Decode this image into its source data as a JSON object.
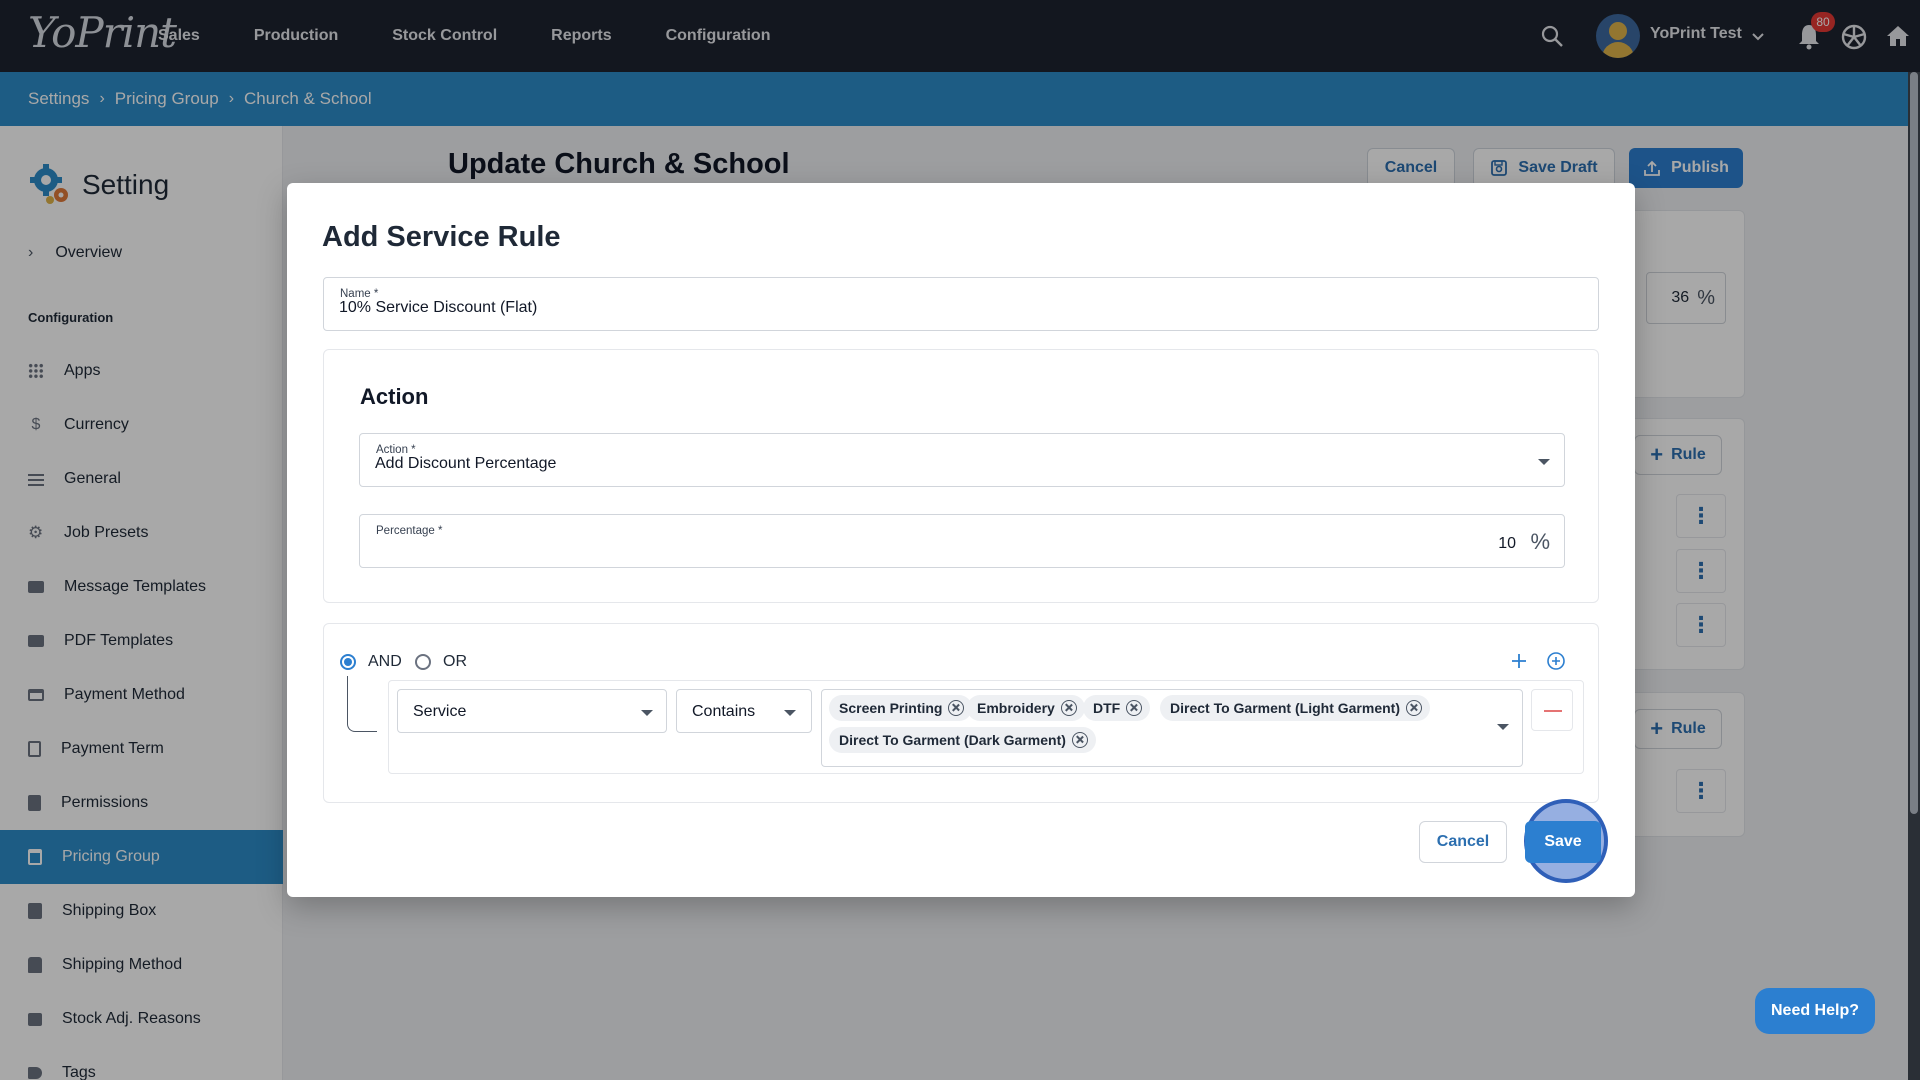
{
  "app": {
    "logo_text": "YoPrint"
  },
  "topnav": {
    "items": [
      "Sales",
      "Production",
      "Stock Control",
      "Reports",
      "Configuration"
    ],
    "user_name": "YoPrint Test",
    "notification_count": "80"
  },
  "breadcrumb": [
    "Settings",
    "Pricing Group",
    "Church & School"
  ],
  "sidebar": {
    "title": "Setting",
    "overview": "Overview",
    "section_label": "Configuration",
    "items": [
      {
        "label": "Apps",
        "icon": "apps-grid-icon"
      },
      {
        "label": "Currency",
        "icon": "dollar-icon"
      },
      {
        "label": "General",
        "icon": "sliders-icon"
      },
      {
        "label": "Job Presets",
        "icon": "gear-icon"
      },
      {
        "label": "Message Templates",
        "icon": "envelope-icon"
      },
      {
        "label": "PDF Templates",
        "icon": "envelope-icon"
      },
      {
        "label": "Payment Method",
        "icon": "card-icon"
      },
      {
        "label": "Payment Term",
        "icon": "clipboard-icon"
      },
      {
        "label": "Permissions",
        "icon": "list-icon"
      },
      {
        "label": "Pricing Group",
        "icon": "calendar-icon",
        "active": true
      },
      {
        "label": "Shipping Box",
        "icon": "box-icon"
      },
      {
        "label": "Shipping Method",
        "icon": "truck-icon"
      },
      {
        "label": "Stock Adj. Reasons",
        "icon": "comment-icon"
      },
      {
        "label": "Tags",
        "icon": "tag-icon"
      }
    ]
  },
  "page": {
    "title": "Update Church & School",
    "cancel_label": "Cancel",
    "save_draft_label": "Save Draft",
    "publish_label": "Publish",
    "bg_percent_value": "36",
    "rule_label": "Rule",
    "need_help_label": "Need Help?"
  },
  "modal": {
    "title": "Add Service Rule",
    "name_label": "Name *",
    "name_value": "10% Service Discount (Flat)",
    "action_heading": "Action",
    "action_label": "Action *",
    "action_value": "Add Discount Percentage",
    "percentage_label": "Percentage *",
    "percentage_value": "10",
    "percent_symbol": "%",
    "logic": {
      "and_label": "AND",
      "or_label": "OR",
      "selected": "AND"
    },
    "condition": {
      "field": "Service",
      "operator": "Contains",
      "values": [
        "Screen Printing",
        "Embroidery",
        "DTF",
        "Direct To Garment (Light Garment)",
        "Direct To Garment (Dark Garment)"
      ]
    },
    "cancel_label": "Cancel",
    "save_label": "Save"
  },
  "colors": {
    "nav_bg": "#1e2430",
    "accent": "#2c8cc9",
    "button_primary": "#2c7fd0",
    "badge": "#e53935"
  }
}
